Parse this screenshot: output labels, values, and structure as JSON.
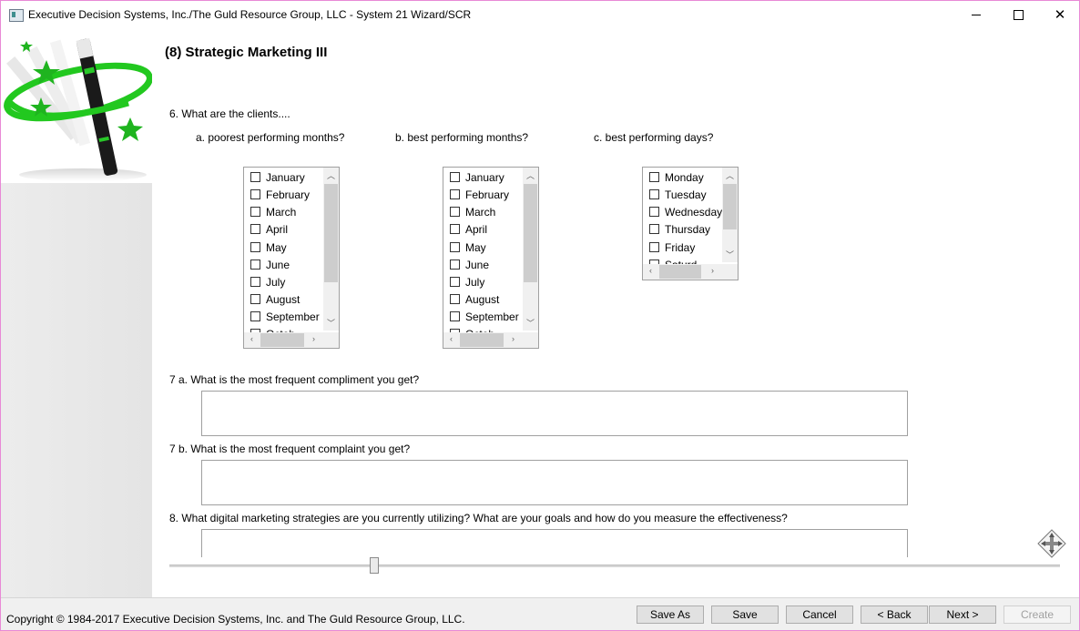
{
  "window": {
    "title": "Executive Decision Systems, Inc./The Guld Resource Group, LLC - System 21 Wizard/SCR"
  },
  "page": {
    "title": "(8) Strategic Marketing III"
  },
  "q6": {
    "label": "6. What are the clients....",
    "a_label": "a. poorest performing months?",
    "b_label": "b. best performing months?",
    "c_label": "c. best performing days?",
    "months": [
      "January",
      "February",
      "March",
      "April",
      "May",
      "June",
      "July",
      "August",
      "September",
      "Octob"
    ],
    "days": [
      "Monday",
      "Tuesday",
      "Wednesday",
      "Thursday",
      "Friday",
      "Saturd"
    ]
  },
  "q7a": {
    "label": "7 a. What is the most frequent compliment you get?",
    "value": ""
  },
  "q7b": {
    "label": "7 b. What is the most frequent complaint you get?",
    "value": ""
  },
  "q8": {
    "label": "8. What digital marketing strategies are you currently utilizing?  What are your goals and how do you measure the effectiveness?",
    "value": ""
  },
  "status": {
    "copyright": "Copyright © 1984-2017 Executive Decision Systems, Inc. and The Guld Resource Group, LLC."
  },
  "buttons": {
    "save_as": "Save As",
    "save": "Save",
    "cancel": "Cancel",
    "back": "< Back",
    "next": "Next >",
    "create": "Create"
  },
  "icons": {
    "logo": "magic-wand-logo",
    "move": "move-arrows-icon",
    "scroll_up": "chevron-up-icon",
    "scroll_down": "chevron-down-icon",
    "scroll_left": "chevron-left-icon",
    "scroll_right": "chevron-right-icon"
  },
  "colors": {
    "accent_green": "#22c81f",
    "window_border": "#e889d6"
  }
}
